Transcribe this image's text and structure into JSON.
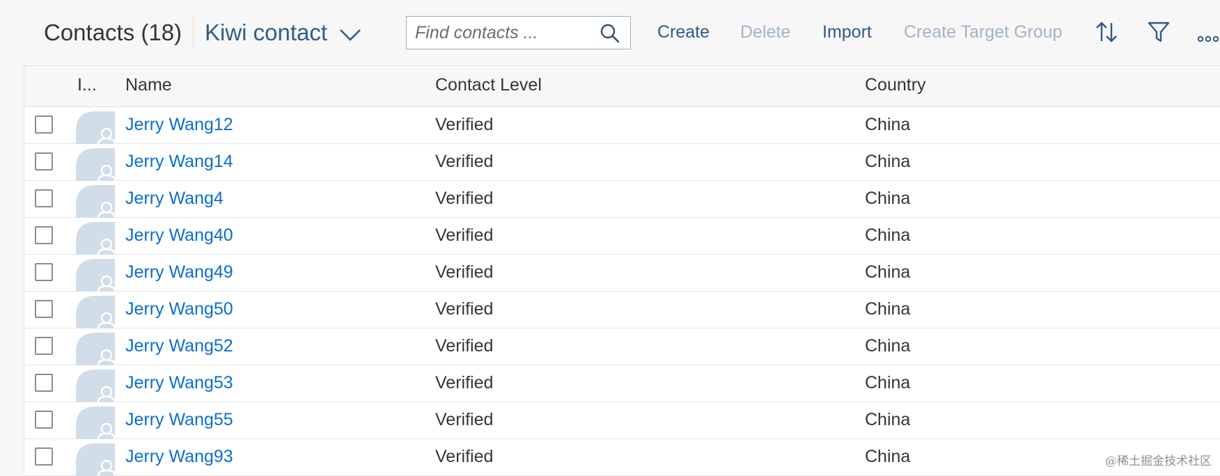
{
  "header": {
    "title": "Contacts (18)",
    "variant": "Kiwi contact",
    "search": {
      "placeholder": "Find contacts ..."
    },
    "actions": {
      "create": "Create",
      "delete": "Delete",
      "import": "Import",
      "create_target_group": "Create Target Group"
    },
    "icons": [
      "chevron-down-icon",
      "search-icon",
      "sort-icon",
      "filter-icon",
      "overflow-icon"
    ]
  },
  "table": {
    "columns": {
      "image": "I...",
      "name": "Name",
      "contact_level": "Contact Level",
      "country": "Country"
    },
    "rows": [
      {
        "name": "Jerry Wang12",
        "level": "Verified",
        "country": "China"
      },
      {
        "name": "Jerry Wang14",
        "level": "Verified",
        "country": "China"
      },
      {
        "name": "Jerry Wang4",
        "level": "Verified",
        "country": "China"
      },
      {
        "name": "Jerry Wang40",
        "level": "Verified",
        "country": "China"
      },
      {
        "name": "Jerry Wang49",
        "level": "Verified",
        "country": "China"
      },
      {
        "name": "Jerry Wang50",
        "level": "Verified",
        "country": "China"
      },
      {
        "name": "Jerry Wang52",
        "level": "Verified",
        "country": "China"
      },
      {
        "name": "Jerry Wang53",
        "level": "Verified",
        "country": "China"
      },
      {
        "name": "Jerry Wang55",
        "level": "Verified",
        "country": "China"
      },
      {
        "name": "Jerry Wang93",
        "level": "Verified",
        "country": "China"
      }
    ]
  },
  "watermark": "@稀土掘金技术社区",
  "colors": {
    "link": "#0a6ed1",
    "action": "#2f5a86",
    "disabled": "#a3b3c6",
    "avatar": "#d1dde9"
  }
}
